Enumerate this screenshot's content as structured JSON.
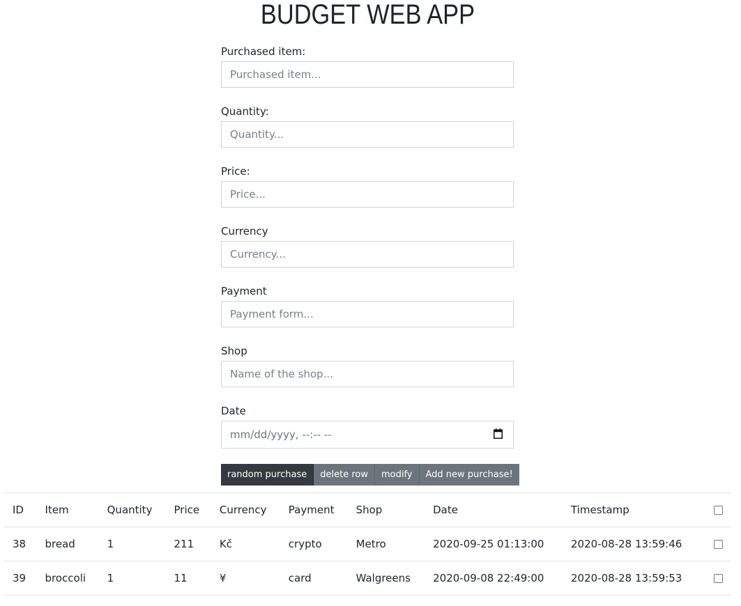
{
  "app": {
    "title": "BUDGET WEB APP"
  },
  "form": {
    "fields": [
      {
        "label": "Purchased item:",
        "placeholder": "Purchased item...",
        "value": ""
      },
      {
        "label": "Quantity:",
        "placeholder": "Quantity...",
        "value": ""
      },
      {
        "label": "Price:",
        "placeholder": "Price...",
        "value": ""
      },
      {
        "label": "Currency",
        "placeholder": "Currency...",
        "value": ""
      },
      {
        "label": "Payment",
        "placeholder": "Payment form...",
        "value": ""
      },
      {
        "label": "Shop",
        "placeholder": "Name of the shop...",
        "value": ""
      }
    ],
    "date": {
      "label": "Date",
      "placeholder": "mm/dd/yyyy, --:-- --",
      "icon": "calendar-icon"
    }
  },
  "buttons": {
    "random": "random purchase",
    "delete": "delete row",
    "modify": "modify",
    "add": "Add new purchase!"
  },
  "table": {
    "headers": [
      "ID",
      "Item",
      "Quantity",
      "Price",
      "Currency",
      "Payment",
      "Shop",
      "Date",
      "Timestamp"
    ],
    "rows": [
      [
        "38",
        "bread",
        "1",
        "211",
        "Kč",
        "crypto",
        "Metro",
        "2020-09-25 01:13:00",
        "2020-08-28 13:59:46"
      ],
      [
        "39",
        "broccoli",
        "1",
        "11",
        "¥",
        "card",
        "Walgreens",
        "2020-09-08 22:49:00",
        "2020-08-28 13:59:53"
      ]
    ]
  },
  "colors": {
    "dark_button": "#343a40",
    "secondary_button": "#6c757d",
    "border": "#dee2e6"
  }
}
